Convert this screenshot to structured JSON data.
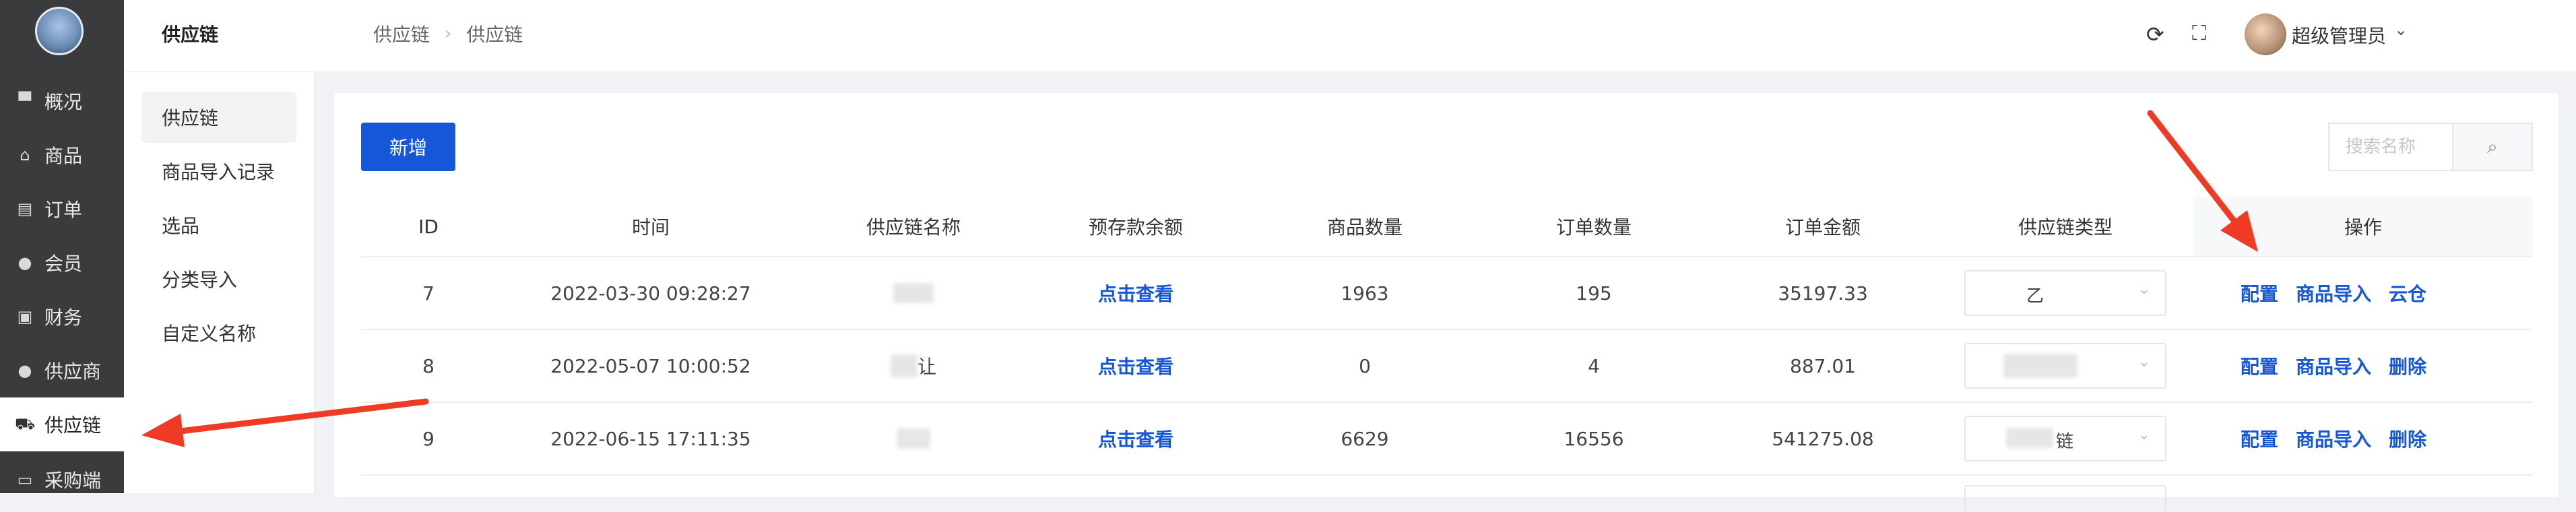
{
  "left_nav": {
    "items": [
      {
        "icon": "monitor-icon",
        "label": "概况"
      },
      {
        "icon": "shopping-bag-icon",
        "label": "商品"
      },
      {
        "icon": "clipboard-icon",
        "label": "订单"
      },
      {
        "icon": "user-icon",
        "label": "会员"
      },
      {
        "icon": "finance-icon",
        "label": "财务"
      },
      {
        "icon": "supplier-icon",
        "label": "供应商"
      },
      {
        "icon": "truck-icon",
        "label": "供应链",
        "active": true
      },
      {
        "icon": "cart-icon",
        "label": "采购端"
      }
    ]
  },
  "sub_nav": {
    "title": "供应链",
    "items": [
      {
        "label": "供应链",
        "active": true
      },
      {
        "label": "商品导入记录"
      },
      {
        "label": "选品"
      },
      {
        "label": "分类导入"
      },
      {
        "label": "自定义名称"
      }
    ]
  },
  "header": {
    "breadcrumb": [
      "供应链",
      "供应链"
    ],
    "username": "超级管理员"
  },
  "toolbar": {
    "add_label": "新增",
    "search_placeholder": "搜索名称"
  },
  "table": {
    "columns": [
      "ID",
      "时间",
      "供应链名称",
      "预存款余额",
      "商品数量",
      "订单数量",
      "订单金额",
      "供应链类型",
      "操作"
    ],
    "rows": [
      {
        "id": "7",
        "time": "2022-03-30 09:28:27",
        "name": "",
        "balance": "点击查看",
        "goods": "1963",
        "orders": "195",
        "amount": "35197.33",
        "type": "乙",
        "ops": [
          "配置",
          "商品导入",
          "云仓"
        ]
      },
      {
        "id": "8",
        "time": "2022-05-07 10:00:52",
        "name": "让",
        "balance": "点击查看",
        "goods": "0",
        "orders": "4",
        "amount": "887.01",
        "type": "",
        "ops": [
          "配置",
          "商品导入",
          "删除"
        ]
      },
      {
        "id": "9",
        "time": "2022-06-15 17:11:35",
        "name": "",
        "balance": "点击查看",
        "goods": "6629",
        "orders": "16556",
        "amount": "541275.08",
        "type": "链",
        "ops": [
          "配置",
          "商品导入",
          "删除"
        ]
      }
    ]
  },
  "colors": {
    "primary": "#1657d8",
    "nav_bg": "#3a3b3d",
    "arrow": "#f03b24"
  }
}
